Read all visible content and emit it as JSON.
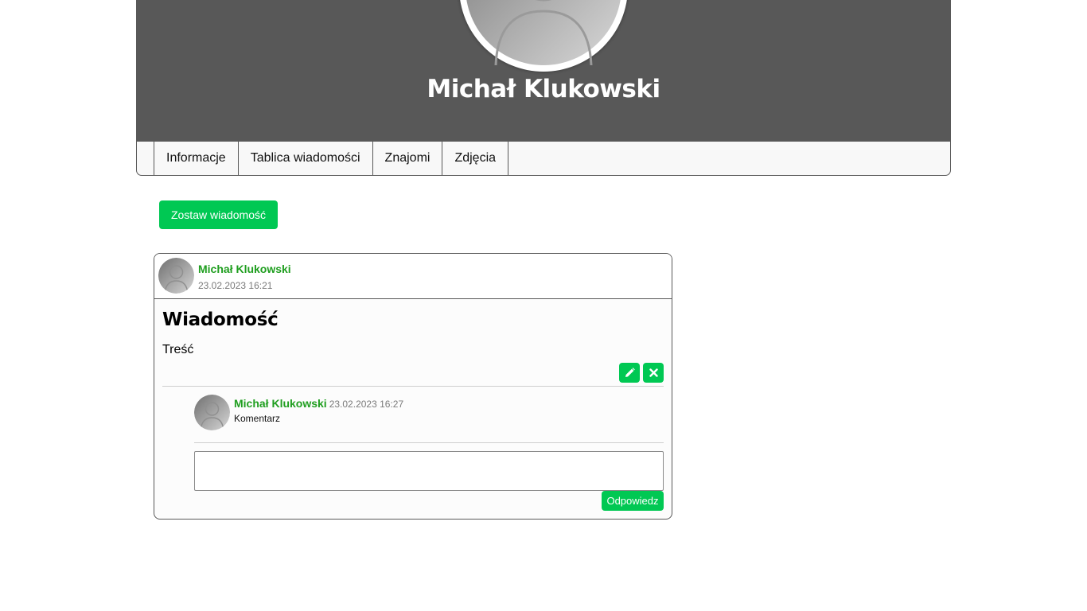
{
  "profile": {
    "name": "Michał Klukowski"
  },
  "tabs": [
    {
      "label": "Informacje"
    },
    {
      "label": "Tablica wiadomości"
    },
    {
      "label": "Znajomi"
    },
    {
      "label": "Zdjęcia"
    }
  ],
  "actions": {
    "leave_message_label": "Zostaw wiadomość"
  },
  "post": {
    "author": "Michał Klukowski",
    "date": "23.02.2023 16:21",
    "title": "Wiadomość",
    "body": "Treść",
    "edit_icon": "pencil-icon",
    "delete_icon": "close-icon",
    "comments": [
      {
        "author": "Michał Klukowski",
        "date": "23.02.2023 16:27",
        "text": "Komentarz"
      }
    ],
    "reply": {
      "value": "",
      "button_label": "Odpowiedz"
    }
  },
  "colors": {
    "banner": "#585858",
    "accent_green": "#00c853",
    "author_green": "#1f9e1f"
  }
}
